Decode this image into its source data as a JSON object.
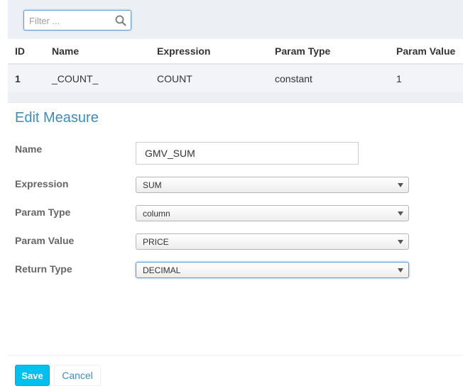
{
  "filter": {
    "placeholder": "Filter ..."
  },
  "table": {
    "columns": [
      "ID",
      "Name",
      "Expression",
      "Param Type",
      "Param Value"
    ],
    "rows": [
      {
        "id": "1",
        "name": "_COUNT_",
        "expression": "COUNT",
        "param_type": "constant",
        "param_value": "1"
      }
    ]
  },
  "edit": {
    "title": "Edit Measure",
    "name_label": "Name",
    "name_value": "GMV_SUM",
    "expression_label": "Expression",
    "expression_value": "SUM",
    "param_type_label": "Param Type",
    "param_type_value": "column",
    "param_value_label": "Param Value",
    "param_value_value": "PRICE",
    "return_type_label": "Return Type",
    "return_type_value": "DECIMAL"
  },
  "actions": {
    "save": "Save",
    "cancel": "Cancel"
  },
  "colors": {
    "accent": "#3c8dbc",
    "save_button": "#00c0ef",
    "panel_bg": "#ecf0f5"
  }
}
